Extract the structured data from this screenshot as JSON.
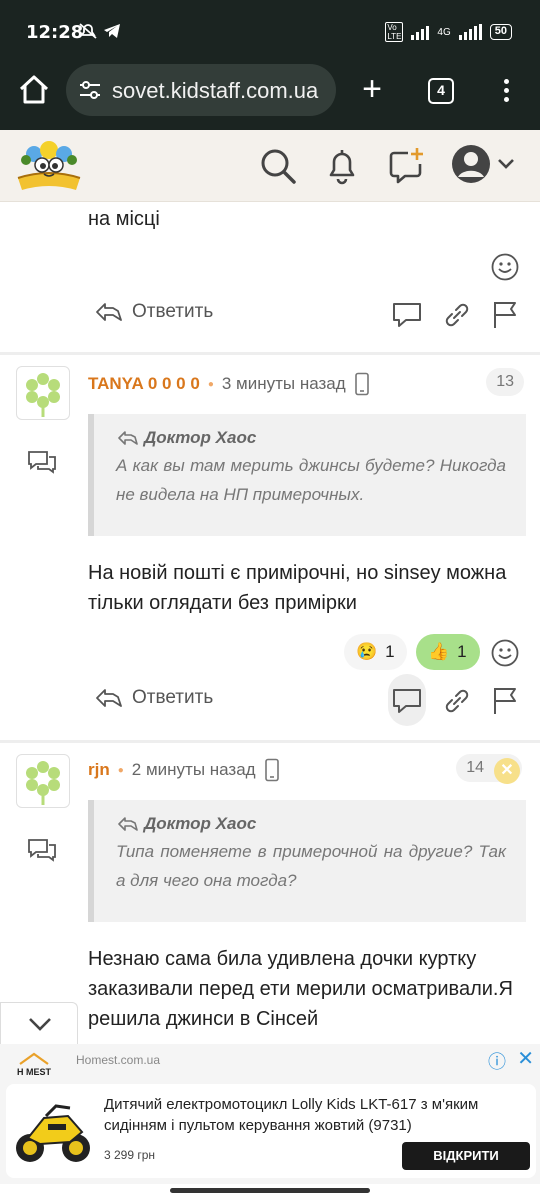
{
  "status_bar": {
    "time": "12:28",
    "network": "4G",
    "battery": "50",
    "icons": [
      "mute-bell-icon",
      "telegram-icon",
      "volte-icon",
      "signal-icon",
      "signal-icon",
      "battery-icon"
    ]
  },
  "browser": {
    "url": "sovet.kidstaff.com.ua",
    "tab_count": "4"
  },
  "site_header": {
    "icons": [
      "search-icon",
      "bell-icon",
      "new-post-icon",
      "avatar-icon",
      "chevron-down-icon"
    ]
  },
  "comments": [
    {
      "text": "на місці",
      "reply_label": "Ответить",
      "reactions": []
    },
    {
      "author": "TANYA 0 0 0 0",
      "time": "3 минуты назад",
      "post_number": "13",
      "quote_author": "Доктор Хаос",
      "quote_text": "А как вы там мерить джинсы будете? Никогда не видела на НП примерочных.",
      "text": "На новій пошті є примірочні, но sinsey можна тільки оглядати без примірки",
      "reactions": [
        {
          "emoji": "😢",
          "count": "1"
        },
        {
          "emoji": "👍",
          "count": "1"
        }
      ],
      "reply_label": "Ответить"
    },
    {
      "author": "rjn",
      "time": "2 минуты назад",
      "post_number": "14",
      "quote_author": "Доктор Хаос",
      "quote_text": "Типа поменяете в примерочной на другие? Так а для чего она тогда?",
      "text": "Незнаю сама била удивлена дочки куртку заказивали перед ети мерили осматривали.Я решила джинси в Сінсей"
    }
  ],
  "ad": {
    "domain": "Homest.com.ua",
    "title": "Дитячий електромотоцикл Lolly Kids LKT-617 з м'яким сидінням і пультом керування жовтий (9731)",
    "price": "3 299 грн",
    "cta": "ВІДКРИТИ",
    "brand": "H MEST"
  },
  "colors": {
    "browser_bg": "#1b2421",
    "author": "#d9771c",
    "like_bg": "#a8e08a",
    "accent_blue": "#2a8fd8"
  }
}
